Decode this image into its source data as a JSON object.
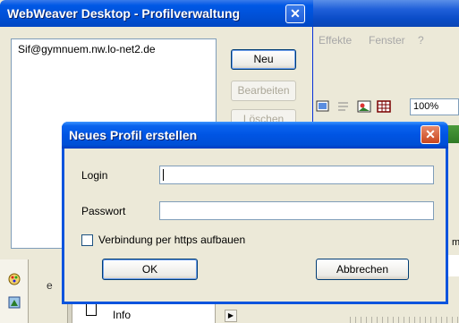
{
  "profile_window": {
    "title": "WebWeaver Desktop - Profilverwaltung",
    "close_label": "✕",
    "profiles": [
      "Sif@gymnuem.nw.lo-net2.de"
    ],
    "buttons": {
      "new": "Neu",
      "edit": "Bearbeiten",
      "delete": "Löschen"
    }
  },
  "new_profile_dialog": {
    "title": "Neues Profil erstellen",
    "close_label": "✕",
    "login_label": "Login",
    "login_value": "",
    "password_label": "Passwort",
    "password_value": "",
    "https_label": "Verbindung per https aufbauen",
    "https_checked": false,
    "ok_label": "OK",
    "cancel_label": "Abbrechen"
  },
  "background_app": {
    "menu": [
      "Effekte",
      "Fenster",
      "?"
    ],
    "zoom": "100%",
    "side_text": "ma",
    "left_text": "e",
    "list_item": "Info"
  },
  "colors": {
    "title_blue": "#0054e3",
    "close_red": "#c9461e",
    "green_bar": "#2f7a25"
  }
}
